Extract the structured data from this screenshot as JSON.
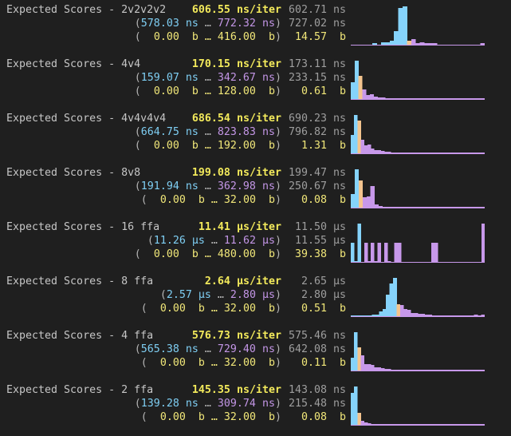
{
  "colors": {
    "background": "#1f1f1f",
    "bar_low": "#85d3fb",
    "bar_mid": "#f4c48e",
    "bar_high": "#c798ea",
    "avg_text": "#f2e95b"
  },
  "benches": [
    {
      "name": "Expected Scores - 2v2v2v2",
      "avg": "606.55",
      "avg_unit": "ns/iter",
      "max_a": "602.71 ns",
      "lo": "578.03",
      "lo_unit": "ns",
      "hi": "772.32",
      "hi_unit": "ns",
      "max_b": "727.02 ns",
      "mem_lo": "0.00",
      "mem_hi": "416.00",
      "mem_unit": "b",
      "mem_val": "14.57",
      "mem_val_unit": "b",
      "hist": [
        0,
        0,
        0,
        0,
        0,
        1,
        0,
        2,
        2,
        3,
        10,
        27,
        28,
        3,
        4,
        1,
        2,
        1,
        1,
        1,
        0,
        0,
        0,
        0,
        0,
        0,
        0,
        0,
        0,
        0,
        1
      ]
    },
    {
      "name": "Expected Scores - 4v4",
      "avg": "170.15",
      "avg_unit": "ns/iter",
      "max_a": "173.11 ns",
      "lo": "159.07",
      "lo_unit": "ns",
      "hi": "342.67",
      "hi_unit": "ns",
      "max_b": "233.15 ns",
      "mem_lo": "0.00",
      "mem_hi": "128.00",
      "mem_unit": "b",
      "mem_val": "0.61",
      "mem_val_unit": "b",
      "hist": [
        22,
        50,
        30,
        13,
        5,
        6,
        3,
        2,
        2,
        1,
        1,
        1,
        1,
        1,
        1,
        1,
        1,
        1,
        1,
        1,
        1,
        1,
        1,
        1,
        1,
        1,
        1,
        1,
        1,
        1,
        1,
        1,
        1,
        1,
        1
      ]
    },
    {
      "name": "Expected Scores - 4v4v4v4",
      "avg": "686.54",
      "avg_unit": "ns/iter",
      "max_a": "690.23 ns",
      "lo": "664.75",
      "lo_unit": "ns",
      "hi": "823.83",
      "hi_unit": "ns",
      "max_b": "796.82 ns",
      "mem_lo": "0.00",
      "mem_hi": "192.00",
      "mem_unit": "b",
      "mem_val": "1.31",
      "mem_val_unit": "b",
      "hist": [
        22,
        45,
        38,
        16,
        9,
        10,
        6,
        4,
        4,
        3,
        2,
        2,
        1,
        1,
        1,
        1,
        1,
        1,
        1,
        1,
        1,
        1,
        1,
        1,
        1,
        1,
        1,
        1,
        1,
        1,
        1,
        1,
        1,
        1,
        1,
        1,
        1,
        1,
        1,
        1
      ]
    },
    {
      "name": "Expected Scores - 8v8",
      "avg": "199.08",
      "avg_unit": "ns/iter",
      "max_a": "199.47 ns",
      "lo": "191.94",
      "lo_unit": "ns",
      "hi": "362.98",
      "hi_unit": "ns",
      "max_b": "250.67 ns",
      "mem_lo": "0.00",
      "mem_hi": "32.00",
      "mem_unit": "b",
      "mem_val": "0.08",
      "mem_val_unit": "b",
      "hist": [
        18,
        50,
        35,
        14,
        15,
        28,
        4,
        2,
        1,
        1,
        1,
        1,
        1,
        1,
        1,
        1,
        1,
        1,
        1,
        1,
        1,
        1,
        1,
        1,
        1,
        1,
        1,
        1,
        1,
        1,
        1,
        1,
        1,
        1
      ]
    },
    {
      "name": "Expected Scores - 16 ffa",
      "avg": "11.41",
      "avg_unit": "µs/iter",
      "max_a": "11.50 µs",
      "lo": "11.26",
      "lo_unit": "µs",
      "hi": "11.62",
      "hi_unit": "µs",
      "max_b": "11.55 µs",
      "mem_lo": "0.00",
      "mem_hi": "480.00",
      "mem_unit": "b",
      "mem_val": "39.38",
      "mem_val_unit": "b",
      "hist": [
        25,
        1,
        50,
        0,
        25,
        1,
        25,
        1,
        25,
        0,
        25,
        1,
        0,
        25,
        25,
        0,
        0,
        0,
        0,
        0,
        0,
        0,
        0,
        0,
        25,
        25,
        0,
        0,
        0,
        0,
        0,
        0,
        0,
        0,
        0,
        0,
        0,
        0,
        0,
        50
      ]
    },
    {
      "name": "Expected Scores - 8 ffa",
      "avg": "2.64",
      "avg_unit": "µs/iter",
      "max_a": "2.65 µs",
      "lo": "2.57",
      "lo_unit": "µs",
      "hi": "2.80",
      "hi_unit": "µs",
      "max_b": "2.80 µs",
      "mem_lo": "0.00",
      "mem_hi": "32.00",
      "mem_unit": "b",
      "mem_val": "0.51",
      "mem_val_unit": "b",
      "hist": [
        1,
        1,
        1,
        1,
        1,
        1,
        2,
        2,
        6,
        9,
        28,
        43,
        50,
        16,
        15,
        9,
        8,
        4,
        4,
        3,
        3,
        2,
        2,
        1,
        1,
        1,
        1,
        1,
        1,
        1,
        1,
        1,
        1,
        1,
        1,
        2,
        1,
        2
      ]
    },
    {
      "name": "Expected Scores - 4 ffa",
      "avg": "576.73",
      "avg_unit": "ns/iter",
      "max_a": "575.46 ns",
      "lo": "565.38",
      "lo_unit": "ns",
      "hi": "729.40",
      "hi_unit": "ns",
      "max_b": "642.08 ns",
      "mem_lo": "0.00",
      "mem_hi": "32.00",
      "mem_unit": "b",
      "mem_val": "0.11",
      "mem_val_unit": "b",
      "hist": [
        17,
        50,
        30,
        20,
        8,
        8,
        7,
        4,
        4,
        3,
        2,
        2,
        1,
        1,
        1,
        1,
        1,
        1,
        1,
        1,
        1,
        1,
        1,
        1,
        1,
        1,
        1,
        1,
        1,
        1,
        1,
        1,
        1,
        1,
        1,
        1,
        1,
        1,
        1,
        1
      ]
    },
    {
      "name": "Expected Scores - 2 ffa",
      "avg": "145.35",
      "avg_unit": "ns/iter",
      "max_a": "143.08 ns",
      "lo": "139.28",
      "lo_unit": "ns",
      "hi": "309.74",
      "hi_unit": "ns",
      "max_b": "215.48 ns",
      "mem_lo": "0.00",
      "mem_hi": "32.00",
      "mem_unit": "b",
      "mem_val": "0.08",
      "mem_val_unit": "b",
      "hist": [
        42,
        50,
        16,
        5,
        3,
        2,
        1,
        1,
        1,
        1,
        1,
        1,
        1,
        1,
        1,
        1,
        1,
        1,
        1,
        1,
        1,
        1,
        1,
        1,
        1,
        1,
        1,
        1,
        1,
        1,
        1,
        1,
        1,
        1,
        1,
        1,
        1,
        1,
        1,
        1
      ]
    }
  ]
}
